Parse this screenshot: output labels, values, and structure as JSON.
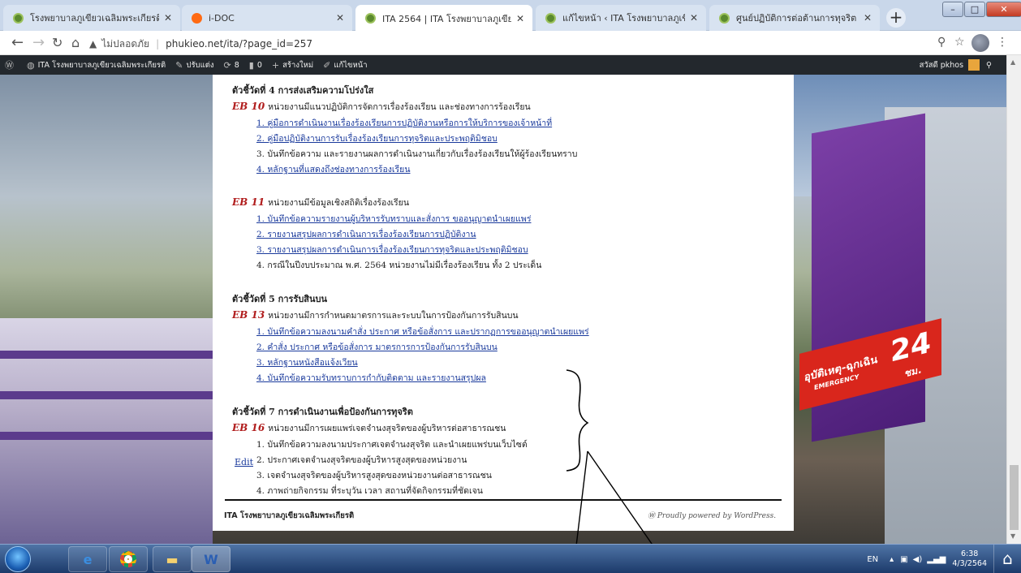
{
  "browser": {
    "tabs": [
      {
        "title": "โรงพยาบาลภูเขียวเฉลิมพระเกียรติ",
        "favicon": "wordpress-green-icon"
      },
      {
        "title": "i-DOC",
        "favicon": "idoc-orange-icon"
      },
      {
        "title": "ITA 2564 | ITA โรงพยาบาลภูเขียว",
        "favicon": "wordpress-green-icon"
      },
      {
        "title": "แก้ไขหน้า ‹ ITA โรงพยาบาลภูเขียว",
        "favicon": "wordpress-green-icon"
      },
      {
        "title": "ศูนย์ปฏิบัติการต่อต้านการทุจริต กร",
        "favicon": "wordpress-green-icon"
      }
    ],
    "active_tab": 2,
    "new_tab": "+",
    "address": {
      "insecure_label": "ไม่ปลอดภัย",
      "url": "phukieo.net/ita/?page_id=257"
    }
  },
  "adminbar": {
    "site_name": "ITA โรงพยาบาลภูเขียวเฉลิมพระเกียรติ",
    "customize": "ปรับแต่ง",
    "updates_count": "8",
    "comments_count": "0",
    "new_label": "สร้างใหม่",
    "edit_label": "แก้ไขหน้า",
    "user": "สวัสดี pkhos"
  },
  "content": {
    "sections": [
      {
        "heading": "ตัวชี้วัดที่ 4 การส่งเสริมความโปร่งใส",
        "eb_code": "EB 10",
        "eb_text": "หน่วยงานมีแนวปฏิบัติการจัดการเรื่องร้องเรียน และช่องทางการร้องเรียน",
        "items": [
          {
            "text": "1. คู่มือการดำเนินงานเรื่องร้องเรียนการปฏิบัติงานหรือการให้บริการของเจ้าหน้าที่",
            "link": true
          },
          {
            "text": "2. คู่มือปฏิบัติงานการรับเรื่องร้องเรียนการทุจริตและประพฤติมิชอบ",
            "link": true
          },
          {
            "text": "3. บันทึกข้อความ และรายงานผลการดำเนินงานเกี่ยวกับเรื่องร้องเรียนให้ผู้ร้องเรียนทราบ",
            "link": false
          },
          {
            "text": "4. หลักฐานที่แสดงถึงช่องทางการร้องเรียน",
            "link": true
          }
        ]
      },
      {
        "heading": "",
        "eb_code": "EB 11",
        "eb_text": "หน่วยงานมีข้อมูลเชิงสถิติเรื่องร้องเรียน",
        "items": [
          {
            "text": "1. บันทึกข้อความรายงานผู้บริหารรับทราบและสั่งการ ขออนุญาตนำเผยแพร่",
            "link": true
          },
          {
            "text": "2. รายงานสรุปผลการดำเนินการเรื่องร้องเรียนการปฏิบัติงาน",
            "link": true
          },
          {
            "text": "3. รายงานสรุปผลการดำเนินการเรื่องร้องเรียนการทุจริตและประพฤติมิชอบ",
            "link": true
          },
          {
            "text": "4. กรณีในปีงบประมาณ พ.ศ. 2564 หน่วยงานไม่มีเรื่องร้องเรียน ทั้ง 2 ประเด็น",
            "link": false
          }
        ]
      },
      {
        "heading": "ตัวชี้วัดที่ 5 การรับสินบน",
        "eb_code": "EB 13",
        "eb_text": "หน่วยงานมีการกำหนดมาตรการและระบบในการป้องกันการรับสินบน",
        "items": [
          {
            "text": "1. บันทึกข้อความลงนามคำสั่ง ประกาศ หรือข้อสั่งการ และปรากฏการขออนุญาตนำเผยแพร่",
            "link": true
          },
          {
            "text": "2. คำสั่ง ประกาศ หรือข้อสั่งการ มาตรการการป้องกันการรับสินบน",
            "link": true
          },
          {
            "text": "3. หลักฐานหนังสือแจ้งเวียน",
            "link": true
          },
          {
            "text": "4. บันทึกข้อความรับทราบการกำกับติดตาม และรายงานสรุปผล",
            "link": true
          }
        ]
      },
      {
        "heading": "ตัวชี้วัดที่ 7 การดำเนินงานเพื่อป้องกันการทุจริต",
        "eb_code": "EB 16",
        "eb_text": "หน่วยงานมีการเผยแพร่เจตจำนงสุจริตของผู้บริหารต่อสาธารณชน",
        "items": [
          {
            "text": "1. บันทึกข้อความลงนามประกาศเจตจำนงสุจริต และนำเผยแพร่บนเว็บไซต์",
            "link": false
          },
          {
            "text": "2. ประกาศเจตจำนงสุจริตของผู้บริหารสูงสุดของหน่วยงาน",
            "link": false
          },
          {
            "text": "3. เจตจำนงสุจริตของผู้บริหารสูงสุดของหน่วยงานต่อสาธารณชน",
            "link": false
          },
          {
            "text": "4. ภาพถ่ายกิจกรรม ที่ระบุวัน เวลา สถานที่จัดกิจกรรมที่ชัดเจน",
            "link": false
          }
        ]
      }
    ],
    "edit_link": "Edit",
    "footer_left": "ITA โรงพยาบาลภูเขียวเฉลิมพระเกียรติ",
    "footer_right": "Proudly powered by WordPress."
  },
  "background_sign": {
    "emergency_th": "อุบัติเหตุ-ฉุกเฉิน",
    "emergency_en": "EMERGENCY",
    "hours": "24",
    "hours_unit": "ชม."
  },
  "taskbar": {
    "apps": [
      "internet-explorer-icon",
      "chrome-icon",
      "file-explorer-icon",
      "word-icon"
    ],
    "lang": "EN",
    "time": "6:38",
    "date": "4/3/2564"
  },
  "colors": {
    "eb_code": "#b01c1c",
    "link": "#1a3a9c",
    "adminbar": "#23282d"
  }
}
